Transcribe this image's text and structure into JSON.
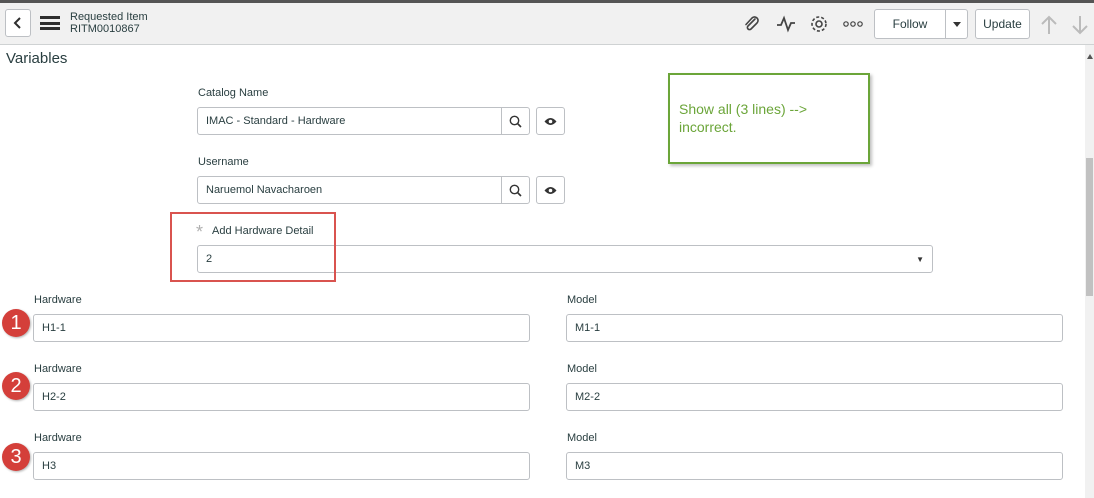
{
  "header": {
    "title": "Requested Item",
    "number": "RITM0010867",
    "follow_label": "Follow",
    "update_label": "Update"
  },
  "section": {
    "title": "Variables"
  },
  "catalog": {
    "label": "Catalog Name",
    "value": "IMAC - Standard - Hardware"
  },
  "username": {
    "label": "Username",
    "value": "Naruemol Navacharoen"
  },
  "add_hw": {
    "required_mark": "*",
    "label": "Add Hardware Detail",
    "value": "2"
  },
  "rows": [
    {
      "badge": "1",
      "hw_label": "Hardware",
      "hw_value": "H1-1",
      "model_label": "Model",
      "model_value": "M1-1"
    },
    {
      "badge": "2",
      "hw_label": "Hardware",
      "hw_value": "H2-2",
      "model_label": "Model",
      "model_value": "M2-2"
    },
    {
      "badge": "3",
      "hw_label": "Hardware",
      "hw_value": "H3",
      "model_label": "Model",
      "model_value": "M3"
    }
  ],
  "note": {
    "text": "Show all (3 lines) --> incorrect."
  },
  "icons": {
    "back": "chevron-left-icon",
    "menu": "hamburger-icon",
    "attachment": "paperclip-icon",
    "activity": "activity-icon",
    "settings": "gear-icon",
    "more": "more-options-icon",
    "search": "search-icon",
    "preview": "eye-icon",
    "up": "arrow-up-icon",
    "down": "arrow-down-icon"
  },
  "colors": {
    "annotation_red": "#d9534f",
    "note_green": "#6ba539",
    "badge_red": "#d43f3a"
  }
}
